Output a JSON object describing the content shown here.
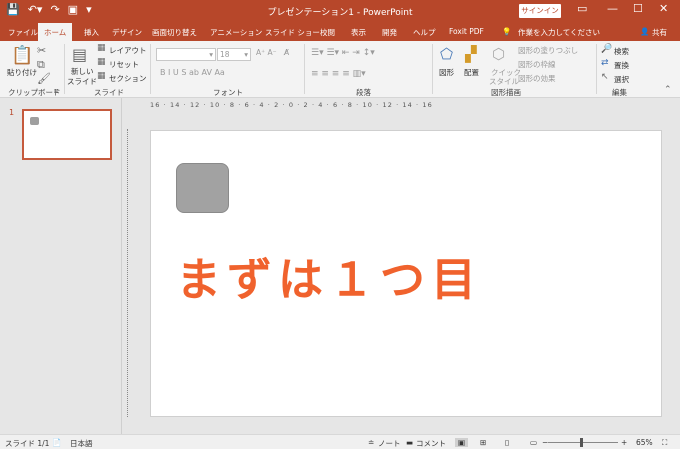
{
  "window": {
    "title": "プレゼンテーション1  -  PowerPoint",
    "signin_label": "サインイン",
    "qat_icons": [
      "save-icon",
      "undo-icon",
      "redo-icon",
      "start-from-beginning-icon",
      "customize-qat-icon"
    ],
    "controls": [
      "ribbon-display-icon",
      "minimize-icon",
      "maximize-icon",
      "close-icon"
    ]
  },
  "tabs": [
    {
      "label": "ファイル"
    },
    {
      "label": "ホーム"
    },
    {
      "label": "挿入"
    },
    {
      "label": "デザイン"
    },
    {
      "label": "画面切り替え"
    },
    {
      "label": "アニメーション"
    },
    {
      "label": "スライド ショー"
    },
    {
      "label": "校閲"
    },
    {
      "label": "表示"
    },
    {
      "label": "開発"
    },
    {
      "label": "ヘルプ"
    },
    {
      "label": "Foxit PDF"
    },
    {
      "label": "作業を入力してください"
    },
    {
      "label": "共有"
    }
  ],
  "ribbon": {
    "clipboard": {
      "paste": "貼り付け",
      "group": "クリップボード"
    },
    "slides": {
      "new_slide_1": "新しい",
      "new_slide_2": "スライド",
      "layout": "レイアウト",
      "reset": "リセット",
      "section": "セクション",
      "group": "スライド"
    },
    "font": {
      "font_name": "",
      "font_size": "18",
      "buttons": "B  I  U  S  ab  AV  Aa",
      "group": "フォント"
    },
    "paragraph": {
      "group": "段落"
    },
    "drawing": {
      "shapes": "図形",
      "arrange": "配置",
      "quick_styles_1": "クイック",
      "quick_styles_2": "スタイル",
      "fill": "図形の塗りつぶし",
      "outline": "図形の枠線",
      "effects": "図形の効果",
      "group": "図形描画"
    },
    "editing": {
      "find": "検索",
      "replace": "置換",
      "select": "選択",
      "group": "編集"
    }
  },
  "thumbnail": {
    "number": "1"
  },
  "ruler": {
    "h_ticks": "16 · 14 · 12 · 10 · 8 · 6 · 4 · 2 · 0 · 2 · 4 · 6 · 8 · 10 · 12 · 14 · 16"
  },
  "slide": {
    "text": "まずは１つ目"
  },
  "status": {
    "slide_info": "スライド 1/1",
    "language": "日本語",
    "notes": "ノート",
    "comments": "コメント",
    "zoom": "65%"
  }
}
